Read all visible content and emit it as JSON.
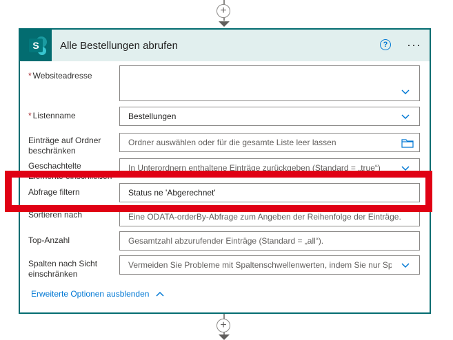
{
  "card": {
    "title": "Alle Bestellungen abrufen",
    "help": "?",
    "more": "···",
    "logo": "S",
    "accent": "#036c70"
  },
  "fields": {
    "website": {
      "label": "Websiteadresse",
      "required": "*",
      "value": ""
    },
    "list": {
      "label": "Listenname",
      "required": "*",
      "value": "Bestellungen"
    },
    "folder": {
      "label": "Einträge auf Ordner beschränken",
      "placeholder": "Ordner auswählen oder für die gesamte Liste leer lassen"
    },
    "nested": {
      "label": "Geschachtelte Elemente einschließen",
      "placeholder": "In Unterordnern enthaltene Einträge zurückgeben (Standard = „true“)"
    },
    "filter": {
      "label": "Abfrage filtern",
      "value": "Status ne 'Abgerechnet'"
    },
    "order": {
      "label": "Sortieren nach",
      "placeholder": "Eine ODATA-orderBy-Abfrage zum Angeben der Reihenfolge der Einträge."
    },
    "top": {
      "label": "Top-Anzahl",
      "placeholder": "Gesamtzahl abzurufender Einträge (Standard = „all“)."
    },
    "view": {
      "label": "Spalten nach Sicht einschränken",
      "placeholder": "Vermeiden Sie Probleme mit Spaltenschwellenwerten, indem Sie nur Spalten aus einer Sicht verwenden"
    }
  },
  "advanced": {
    "label": "Erweiterte Optionen ausblenden"
  },
  "connectors": {
    "plus": "+"
  },
  "colors": {
    "highlight": "#e00014",
    "link": "#0078d4"
  }
}
